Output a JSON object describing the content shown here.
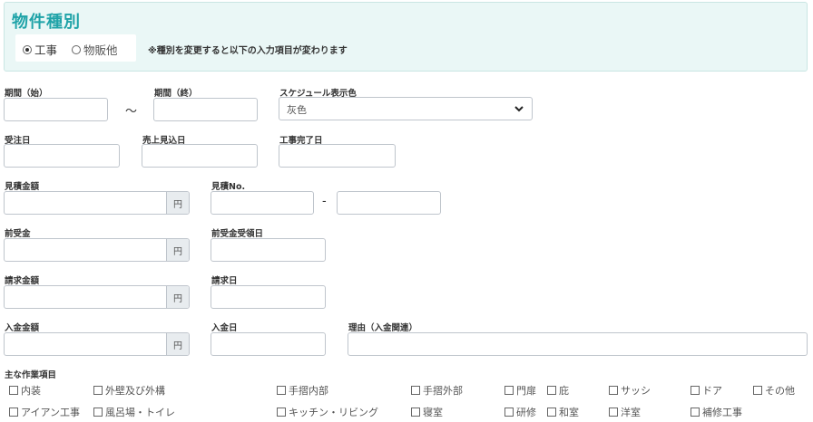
{
  "property_type": {
    "title": "物件種別",
    "options": [
      "工事",
      "物販他"
    ],
    "note": "※種別を変更すると以下の入力項目が変わります"
  },
  "fields": {
    "period_start": "期間（始）",
    "period_end": "期間（終）",
    "range_sep": "〜",
    "schedule_color": "スケジュール表示色",
    "schedule_color_value": "灰色",
    "order_date": "受注日",
    "sales_expected_date": "売上見込日",
    "completion_date": "工事完了日",
    "estimate_amount": "見積金額",
    "estimate_no": "見積No.",
    "estimate_sep": "-",
    "advance": "前受金",
    "advance_date": "前受金受領日",
    "invoice_amount": "請求金額",
    "invoice_date": "請求日",
    "deposit_amount": "入金金額",
    "deposit_date": "入金日",
    "reason": "理由（入金関連）",
    "yen": "円"
  },
  "work_items": {
    "label": "主な作業項目",
    "row1": [
      "内装",
      "外壁及び外構",
      "手摺内部",
      "手摺外部",
      "門扉",
      "庇",
      "サッシ",
      "ドア",
      "その他"
    ],
    "row2": [
      "アイアン工事",
      "風呂場・トイレ",
      "キッチン・リビング",
      "寝室",
      "研修",
      "和室",
      "洋室",
      "補修工事"
    ]
  }
}
